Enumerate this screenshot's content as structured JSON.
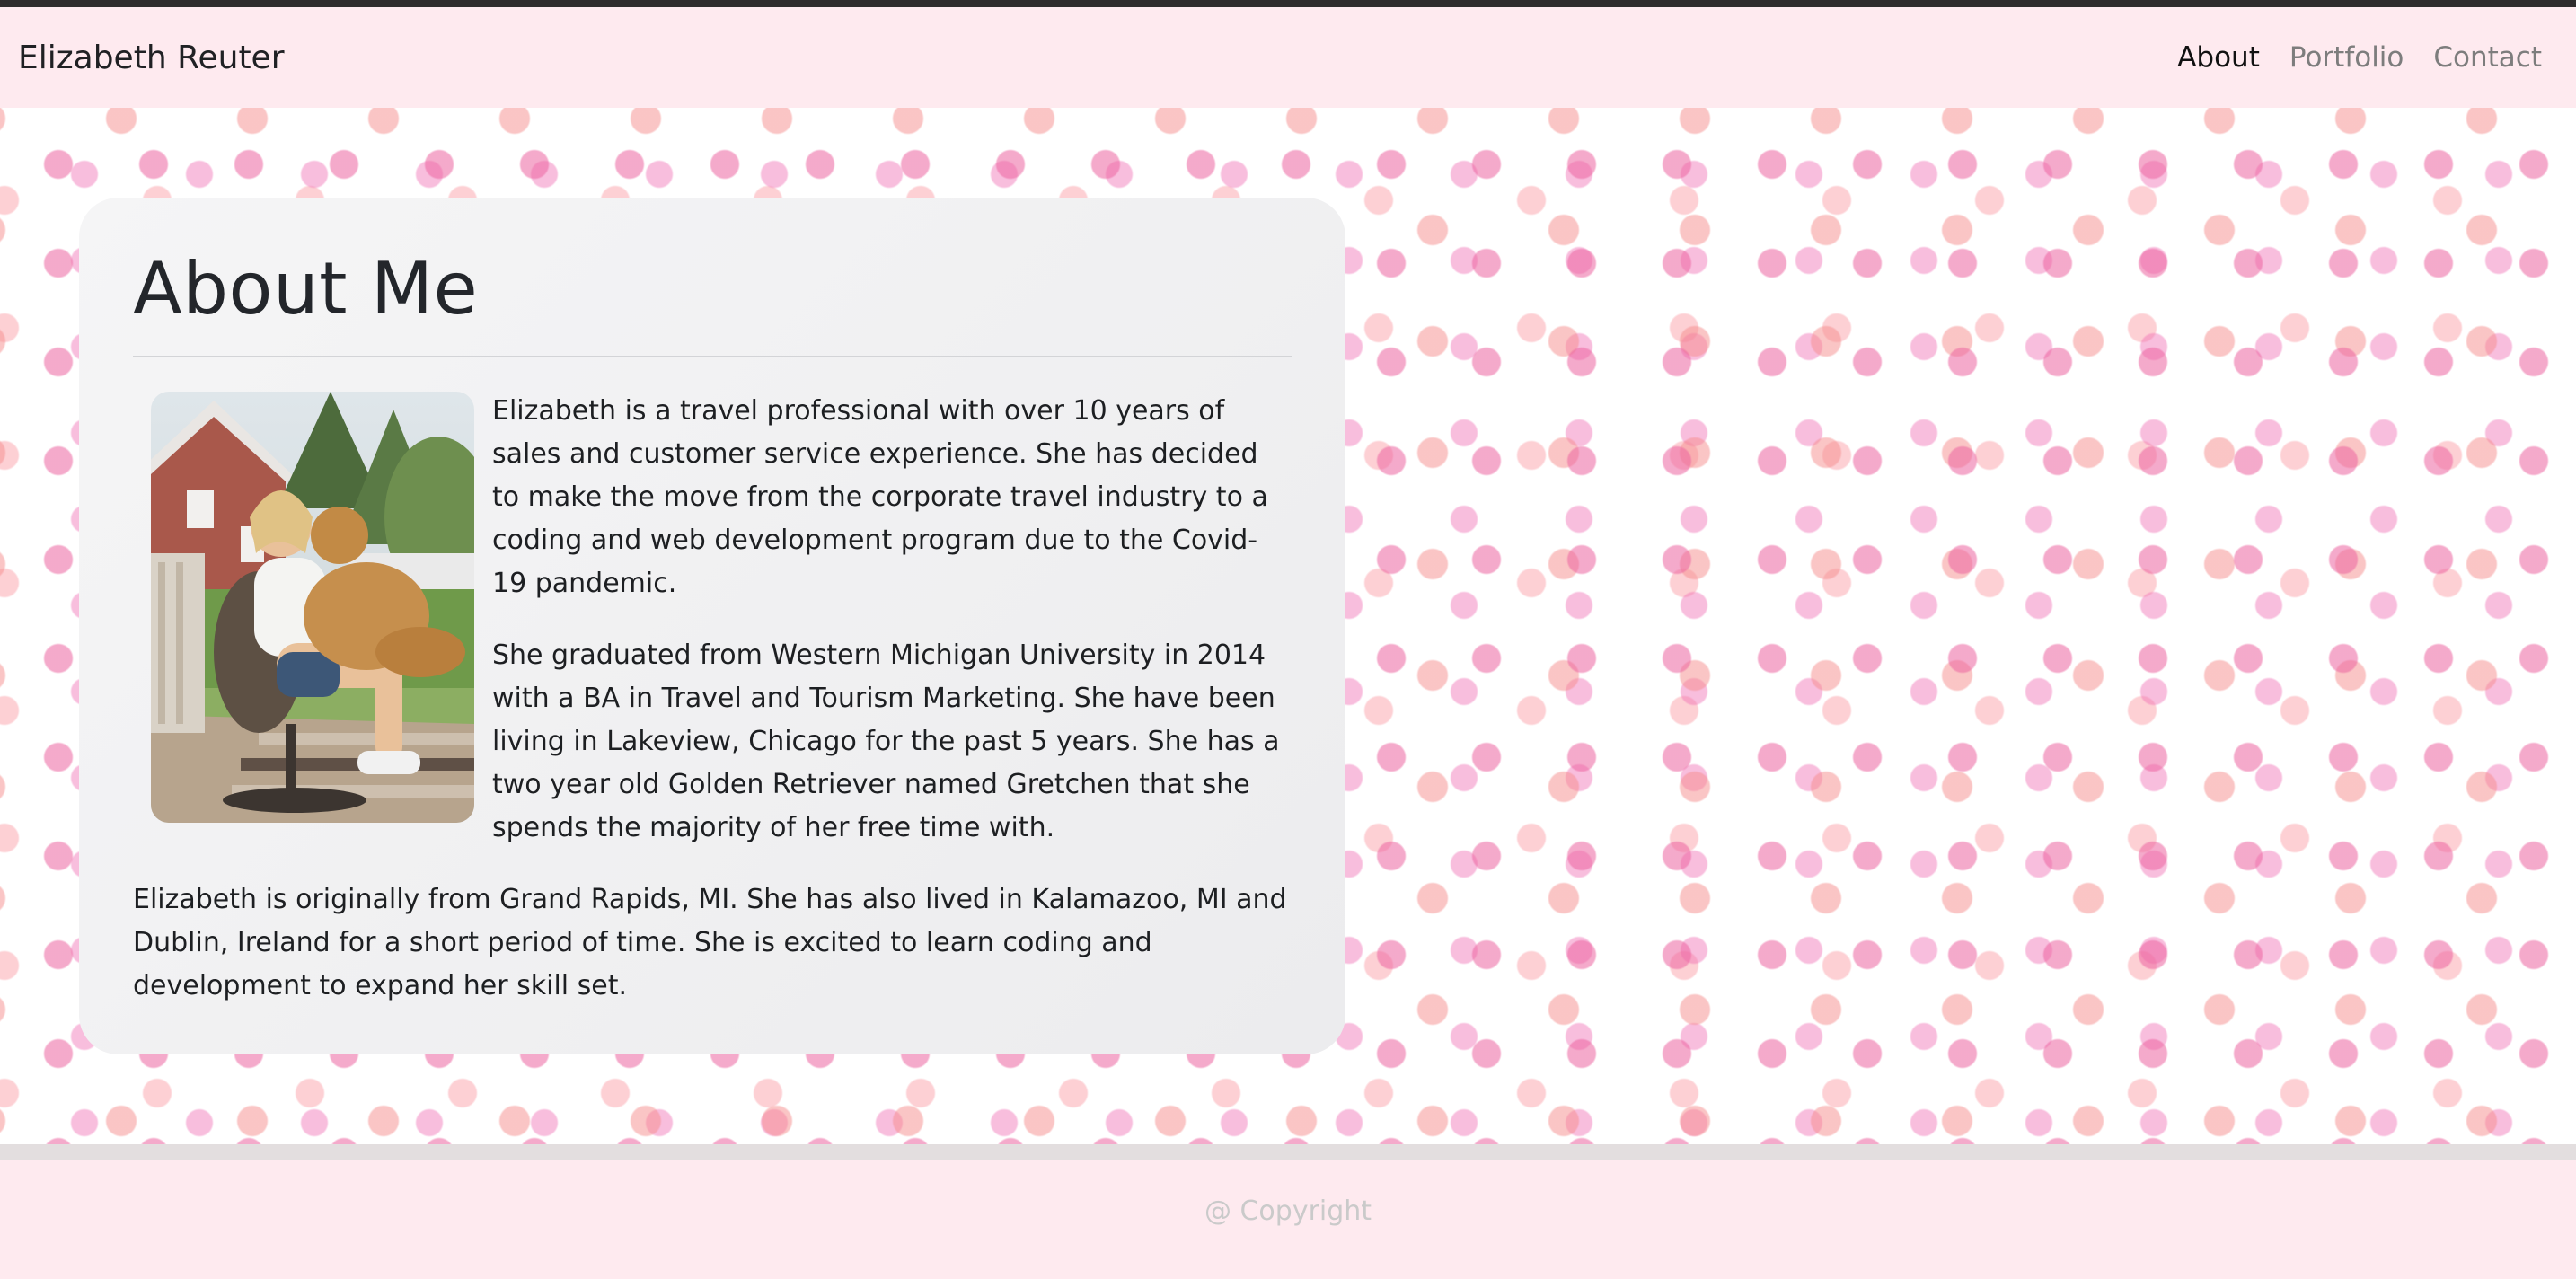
{
  "navbar": {
    "brand": "Elizabeth Reuter",
    "links": [
      {
        "label": "About",
        "active": true
      },
      {
        "label": "Portfolio",
        "active": false
      },
      {
        "label": "Contact",
        "active": false
      }
    ]
  },
  "about": {
    "title": "About Me",
    "paragraphs": [
      "Elizabeth is a travel professional with over 10 years of sales and customer service experience. She has decided to make the move from the corporate travel industry to a coding and web development program due to the Covid-19 pandemic.",
      "She graduated from Western Michigan University in 2014 with a BA in Travel and Tourism Marketing. She have been living in Lakeview, Chicago for the past 5 years. She has a two year old Golden Retriever named Gretchen that she spends the majority of her free time with.",
      "Elizabeth is originally from Grand Rapids, MI. She has also lived in Kalamazoo, MI and Dublin, Ireland for a short period of time. She is excited to learn coding and development to expand her skill set."
    ]
  },
  "footer": {
    "copyright": "@ Copyright"
  },
  "colors": {
    "navbar_bg": "#feeaef",
    "card_bg": "#f0f0f1",
    "polka_dot": "#ec64a0"
  }
}
